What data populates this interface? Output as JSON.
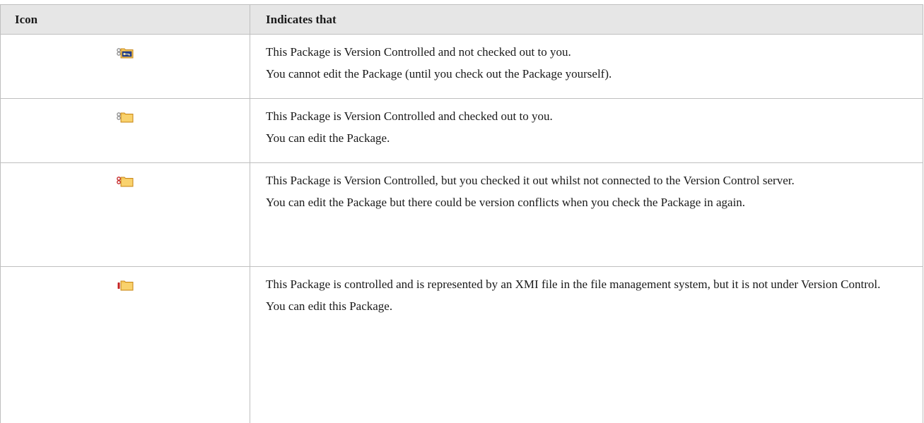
{
  "headers": {
    "icon": "Icon",
    "indicates": "Indicates that"
  },
  "rows": [
    {
      "icon": "version-controlled-checked-in-package-icon",
      "lines": [
        "This Package is Version Controlled and not checked out to you.",
        "You cannot edit the Package (until you check out the Package yourself)."
      ]
    },
    {
      "icon": "version-controlled-checked-out-package-icon",
      "lines": [
        "This Package is Version Controlled and checked out to you.",
        "You can edit the Package."
      ]
    },
    {
      "icon": "version-controlled-offline-checked-out-package-icon",
      "lines": [
        "This Package is Version Controlled, but you checked it out whilst not connected to the Version Control server.",
        "You can edit the Package but there could be version conflicts when you check the Package in again."
      ]
    },
    {
      "icon": "controlled-xmi-package-icon",
      "lines": [
        "This Package is controlled and is represented by an XMI file in the file management system, but it is not under Version Control.",
        "You can edit this Package."
      ]
    }
  ],
  "colors": {
    "header_bg": "#e6e6e6",
    "border": "#bfbfbf",
    "folder_fill": "#f6c85a",
    "folder_outline": "#c8891c",
    "key_panel": "#243f8f",
    "chain_gray": "#8c8c8c",
    "chain_red": "#c42020"
  }
}
